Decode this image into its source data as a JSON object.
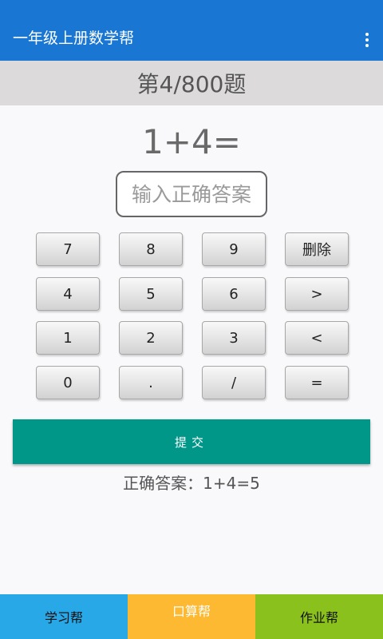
{
  "app": {
    "title": "一年级上册数学帮",
    "menu_icon": "overflow-menu-icon"
  },
  "progress": {
    "label": "第4/800题",
    "current": 4,
    "total": 800
  },
  "question": {
    "text": "1+4="
  },
  "answer_input": {
    "value": "",
    "placeholder": "输入正确答案"
  },
  "keypad": {
    "keys": [
      "7",
      "8",
      "9",
      "删除",
      "4",
      "5",
      "6",
      ">",
      "1",
      "2",
      "3",
      "<",
      "0",
      ".",
      "/",
      "="
    ]
  },
  "submit": {
    "label": "提交"
  },
  "result": {
    "text": "正确答案：1+4=5"
  },
  "bottom_nav": {
    "items": [
      {
        "label": "学习帮",
        "color": "#29a8e7"
      },
      {
        "label": "口算帮",
        "color": "#fdb931"
      },
      {
        "label": "作业帮",
        "color": "#8ac11c"
      }
    ]
  },
  "colors": {
    "appbar": "#1976d2",
    "progress_bg": "#dcdada",
    "submit": "#009688"
  }
}
